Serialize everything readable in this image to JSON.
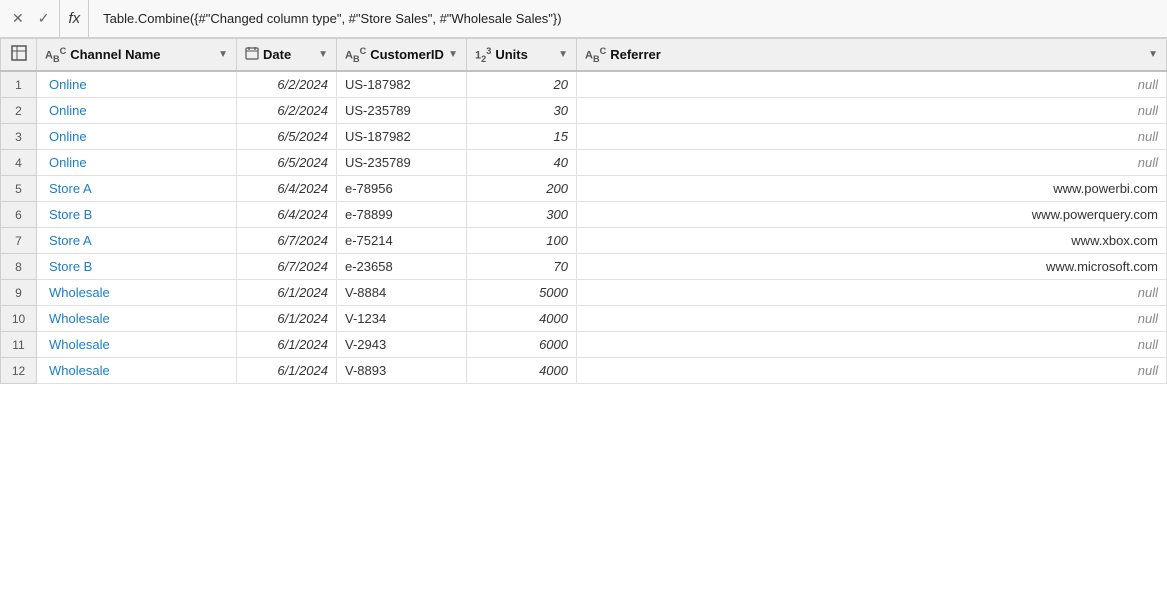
{
  "formulaBar": {
    "cancelLabel": "✕",
    "confirmLabel": "✓",
    "fxLabel": "fx",
    "formula": "Table.Combine({#\"Changed column type\", #\"Store Sales\", #\"Wholesale Sales\"})"
  },
  "table": {
    "columns": [
      {
        "id": "channel",
        "label": "Channel Name",
        "typeIcon": "ABC",
        "typeLabel": "text",
        "hasDropdown": true
      },
      {
        "id": "date",
        "label": "Date",
        "typeIcon": "CAL",
        "typeLabel": "date",
        "hasDropdown": true
      },
      {
        "id": "customer",
        "label": "CustomerID",
        "typeIcon": "ABC",
        "typeLabel": "text",
        "hasDropdown": true
      },
      {
        "id": "units",
        "label": "Units",
        "typeIcon": "123",
        "typeLabel": "number",
        "hasDropdown": true
      },
      {
        "id": "referrer",
        "label": "Referrer",
        "typeIcon": "ABC",
        "typeLabel": "text",
        "hasDropdown": true
      }
    ],
    "rows": [
      {
        "num": 1,
        "channel": "Online",
        "date": "6/2/2024",
        "customer": "US-187982",
        "units": "20",
        "referrer": "null"
      },
      {
        "num": 2,
        "channel": "Online",
        "date": "6/2/2024",
        "customer": "US-235789",
        "units": "30",
        "referrer": "null"
      },
      {
        "num": 3,
        "channel": "Online",
        "date": "6/5/2024",
        "customer": "US-187982",
        "units": "15",
        "referrer": "null"
      },
      {
        "num": 4,
        "channel": "Online",
        "date": "6/5/2024",
        "customer": "US-235789",
        "units": "40",
        "referrer": "null"
      },
      {
        "num": 5,
        "channel": "Store A",
        "date": "6/4/2024",
        "customer": "e-78956",
        "units": "200",
        "referrer": "www.powerbi.com"
      },
      {
        "num": 6,
        "channel": "Store B",
        "date": "6/4/2024",
        "customer": "e-78899",
        "units": "300",
        "referrer": "www.powerquery.com"
      },
      {
        "num": 7,
        "channel": "Store A",
        "date": "6/7/2024",
        "customer": "e-75214",
        "units": "100",
        "referrer": "www.xbox.com"
      },
      {
        "num": 8,
        "channel": "Store B",
        "date": "6/7/2024",
        "customer": "e-23658",
        "units": "70",
        "referrer": "www.microsoft.com"
      },
      {
        "num": 9,
        "channel": "Wholesale",
        "date": "6/1/2024",
        "customer": "V-8884",
        "units": "5000",
        "referrer": "null"
      },
      {
        "num": 10,
        "channel": "Wholesale",
        "date": "6/1/2024",
        "customer": "V-1234",
        "units": "4000",
        "referrer": "null"
      },
      {
        "num": 11,
        "channel": "Wholesale",
        "date": "6/1/2024",
        "customer": "V-2943",
        "units": "6000",
        "referrer": "null"
      },
      {
        "num": 12,
        "channel": "Wholesale",
        "date": "6/1/2024",
        "customer": "V-8893",
        "units": "4000",
        "referrer": "null"
      }
    ]
  }
}
